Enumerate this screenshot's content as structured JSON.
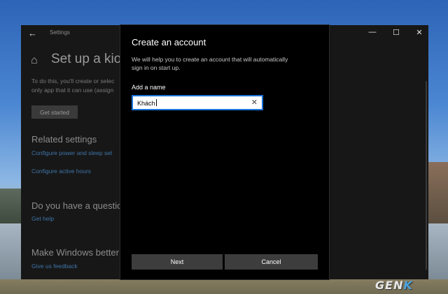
{
  "settings_window": {
    "title": "Settings",
    "page_title": "Set up a kios",
    "description_lines": [
      "To do this, you'll create or selec",
      "only app that it can use (assign"
    ],
    "get_started_label": "Get started",
    "related_settings_title": "Related settings",
    "links": {
      "power_sleep": "Configure power and sleep set",
      "active_hours": "Configure active hours",
      "get_help": "Get help",
      "give_feedback": "Give us feedback"
    },
    "question_title": "Do you have a questio",
    "better_title": "Make Windows better",
    "controls": {
      "minimize": "—",
      "maximize": "☐",
      "close": "✕"
    },
    "back_glyph": "←",
    "home_glyph": "⌂"
  },
  "dialog": {
    "title": "Create an account",
    "description_lines": [
      "We will help you to create an account that will automatically",
      "sign in on start up."
    ],
    "name_label": "Add a name",
    "name_value": "Khách",
    "clear_glyph": "✕",
    "next_label": "Next",
    "cancel_label": "Cancel"
  },
  "watermark": {
    "text_main": "GEN",
    "text_accent": "K"
  },
  "colors": {
    "accent": "#1a73d9",
    "link": "#3f74a8",
    "dialog_bg": "#000000",
    "window_bg": "#171717"
  }
}
